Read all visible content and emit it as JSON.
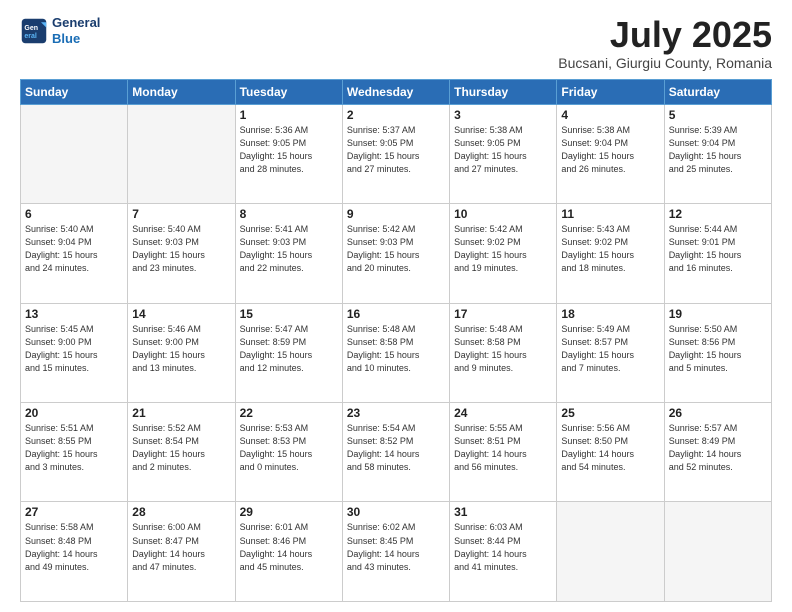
{
  "header": {
    "logo_line1": "General",
    "logo_line2": "Blue",
    "month": "July 2025",
    "location": "Bucsani, Giurgiu County, Romania"
  },
  "days_of_week": [
    "Sunday",
    "Monday",
    "Tuesday",
    "Wednesday",
    "Thursday",
    "Friday",
    "Saturday"
  ],
  "weeks": [
    [
      {
        "num": "",
        "info": ""
      },
      {
        "num": "",
        "info": ""
      },
      {
        "num": "1",
        "info": "Sunrise: 5:36 AM\nSunset: 9:05 PM\nDaylight: 15 hours\nand 28 minutes."
      },
      {
        "num": "2",
        "info": "Sunrise: 5:37 AM\nSunset: 9:05 PM\nDaylight: 15 hours\nand 27 minutes."
      },
      {
        "num": "3",
        "info": "Sunrise: 5:38 AM\nSunset: 9:05 PM\nDaylight: 15 hours\nand 27 minutes."
      },
      {
        "num": "4",
        "info": "Sunrise: 5:38 AM\nSunset: 9:04 PM\nDaylight: 15 hours\nand 26 minutes."
      },
      {
        "num": "5",
        "info": "Sunrise: 5:39 AM\nSunset: 9:04 PM\nDaylight: 15 hours\nand 25 minutes."
      }
    ],
    [
      {
        "num": "6",
        "info": "Sunrise: 5:40 AM\nSunset: 9:04 PM\nDaylight: 15 hours\nand 24 minutes."
      },
      {
        "num": "7",
        "info": "Sunrise: 5:40 AM\nSunset: 9:03 PM\nDaylight: 15 hours\nand 23 minutes."
      },
      {
        "num": "8",
        "info": "Sunrise: 5:41 AM\nSunset: 9:03 PM\nDaylight: 15 hours\nand 22 minutes."
      },
      {
        "num": "9",
        "info": "Sunrise: 5:42 AM\nSunset: 9:03 PM\nDaylight: 15 hours\nand 20 minutes."
      },
      {
        "num": "10",
        "info": "Sunrise: 5:42 AM\nSunset: 9:02 PM\nDaylight: 15 hours\nand 19 minutes."
      },
      {
        "num": "11",
        "info": "Sunrise: 5:43 AM\nSunset: 9:02 PM\nDaylight: 15 hours\nand 18 minutes."
      },
      {
        "num": "12",
        "info": "Sunrise: 5:44 AM\nSunset: 9:01 PM\nDaylight: 15 hours\nand 16 minutes."
      }
    ],
    [
      {
        "num": "13",
        "info": "Sunrise: 5:45 AM\nSunset: 9:00 PM\nDaylight: 15 hours\nand 15 minutes."
      },
      {
        "num": "14",
        "info": "Sunrise: 5:46 AM\nSunset: 9:00 PM\nDaylight: 15 hours\nand 13 minutes."
      },
      {
        "num": "15",
        "info": "Sunrise: 5:47 AM\nSunset: 8:59 PM\nDaylight: 15 hours\nand 12 minutes."
      },
      {
        "num": "16",
        "info": "Sunrise: 5:48 AM\nSunset: 8:58 PM\nDaylight: 15 hours\nand 10 minutes."
      },
      {
        "num": "17",
        "info": "Sunrise: 5:48 AM\nSunset: 8:58 PM\nDaylight: 15 hours\nand 9 minutes."
      },
      {
        "num": "18",
        "info": "Sunrise: 5:49 AM\nSunset: 8:57 PM\nDaylight: 15 hours\nand 7 minutes."
      },
      {
        "num": "19",
        "info": "Sunrise: 5:50 AM\nSunset: 8:56 PM\nDaylight: 15 hours\nand 5 minutes."
      }
    ],
    [
      {
        "num": "20",
        "info": "Sunrise: 5:51 AM\nSunset: 8:55 PM\nDaylight: 15 hours\nand 3 minutes."
      },
      {
        "num": "21",
        "info": "Sunrise: 5:52 AM\nSunset: 8:54 PM\nDaylight: 15 hours\nand 2 minutes."
      },
      {
        "num": "22",
        "info": "Sunrise: 5:53 AM\nSunset: 8:53 PM\nDaylight: 15 hours\nand 0 minutes."
      },
      {
        "num": "23",
        "info": "Sunrise: 5:54 AM\nSunset: 8:52 PM\nDaylight: 14 hours\nand 58 minutes."
      },
      {
        "num": "24",
        "info": "Sunrise: 5:55 AM\nSunset: 8:51 PM\nDaylight: 14 hours\nand 56 minutes."
      },
      {
        "num": "25",
        "info": "Sunrise: 5:56 AM\nSunset: 8:50 PM\nDaylight: 14 hours\nand 54 minutes."
      },
      {
        "num": "26",
        "info": "Sunrise: 5:57 AM\nSunset: 8:49 PM\nDaylight: 14 hours\nand 52 minutes."
      }
    ],
    [
      {
        "num": "27",
        "info": "Sunrise: 5:58 AM\nSunset: 8:48 PM\nDaylight: 14 hours\nand 49 minutes."
      },
      {
        "num": "28",
        "info": "Sunrise: 6:00 AM\nSunset: 8:47 PM\nDaylight: 14 hours\nand 47 minutes."
      },
      {
        "num": "29",
        "info": "Sunrise: 6:01 AM\nSunset: 8:46 PM\nDaylight: 14 hours\nand 45 minutes."
      },
      {
        "num": "30",
        "info": "Sunrise: 6:02 AM\nSunset: 8:45 PM\nDaylight: 14 hours\nand 43 minutes."
      },
      {
        "num": "31",
        "info": "Sunrise: 6:03 AM\nSunset: 8:44 PM\nDaylight: 14 hours\nand 41 minutes."
      },
      {
        "num": "",
        "info": ""
      },
      {
        "num": "",
        "info": ""
      }
    ]
  ]
}
